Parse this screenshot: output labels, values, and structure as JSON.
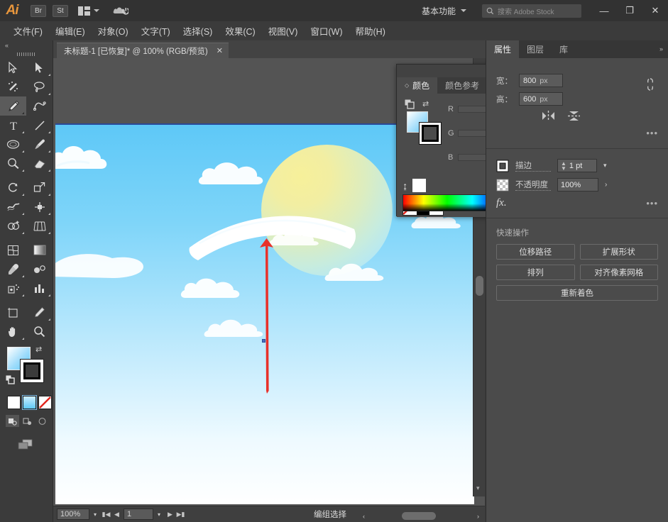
{
  "app": {
    "name": "Ai",
    "logo_label": "Ai"
  },
  "titlebar": {
    "bridge_label": "Br",
    "stock_label": "St",
    "arrange_icon": "arrange-documents-icon",
    "cc_icon": "creative-cloud-icon",
    "workspace": "基本功能",
    "workspace_chevron": "chevron-down-icon",
    "search_icon": "search-icon",
    "search_placeholder": "搜索 Adobe Stock",
    "minimize": "—",
    "maximize": "❐",
    "close": "✕"
  },
  "menubar": {
    "items": [
      {
        "label": "文件(F)"
      },
      {
        "label": "编辑(E)"
      },
      {
        "label": "对象(O)"
      },
      {
        "label": "文字(T)"
      },
      {
        "label": "选择(S)"
      },
      {
        "label": "效果(C)"
      },
      {
        "label": "视图(V)"
      },
      {
        "label": "窗口(W)"
      },
      {
        "label": "帮助(H)"
      }
    ]
  },
  "tabbar": {
    "document_title": "未标题-1 [已恢复]* @ 100% (RGB/预览)",
    "close_label": "✕",
    "overflow_chevron": "chevron-double-left-icon"
  },
  "toolbar": {
    "collapse_icon": "collapse-panel-icon",
    "tools": [
      {
        "name": "selection-tool",
        "selected": false
      },
      {
        "name": "direct-selection-tool",
        "selected": false
      },
      {
        "name": "magic-wand-tool",
        "selected": false
      },
      {
        "name": "lasso-tool",
        "selected": false
      },
      {
        "name": "pen-tool",
        "selected": true
      },
      {
        "name": "curvature-tool",
        "selected": false
      },
      {
        "name": "type-tool",
        "selected": false
      },
      {
        "name": "line-segment-tool",
        "selected": false
      },
      {
        "name": "ellipse-tool",
        "selected": false
      },
      {
        "name": "paintbrush-tool",
        "selected": false
      },
      {
        "name": "shaper-tool",
        "selected": false
      },
      {
        "name": "eraser-tool",
        "selected": false
      },
      {
        "name": "rotate-tool",
        "selected": false
      },
      {
        "name": "scale-tool",
        "selected": false
      },
      {
        "name": "width-tool",
        "selected": false
      },
      {
        "name": "free-transform-tool",
        "selected": false
      },
      {
        "name": "shape-builder-tool",
        "selected": false
      },
      {
        "name": "perspective-grid-tool",
        "selected": false
      },
      {
        "name": "mesh-tool",
        "selected": false
      },
      {
        "name": "gradient-tool",
        "selected": false
      },
      {
        "name": "eyedropper-tool",
        "selected": false
      },
      {
        "name": "blend-tool",
        "selected": false
      },
      {
        "name": "symbol-sprayer-tool",
        "selected": false
      },
      {
        "name": "column-graph-tool",
        "selected": false
      },
      {
        "name": "artboard-tool",
        "selected": false
      },
      {
        "name": "slice-tool",
        "selected": false
      },
      {
        "name": "hand-tool",
        "selected": false
      },
      {
        "name": "zoom-tool",
        "selected": false
      }
    ],
    "fill_label": "fill-swatch",
    "stroke_label": "stroke-swatch",
    "swap_icon": "swap-fill-stroke-icon",
    "default_icon": "default-fill-stroke-icon",
    "color_modes": [
      "color-swatch",
      "gradient-swatch",
      "none-swatch"
    ],
    "draw_modes": [
      "draw-normal",
      "draw-behind",
      "draw-inside"
    ],
    "screen_mode_icon": "change-screen-mode-icon"
  },
  "color_panel": {
    "collapse_icon": "collapse-icon",
    "close_icon": "close-icon",
    "menu_icon": "panel-menu-icon",
    "tabs": [
      {
        "label": "颜色",
        "active": true
      },
      {
        "label": "颜色参考",
        "active": false
      }
    ],
    "sliders": [
      {
        "label": "R",
        "value": ""
      },
      {
        "label": "G",
        "value": ""
      },
      {
        "label": "B",
        "value": ""
      }
    ],
    "hex_label": "#",
    "hex_value": "",
    "spectrum_name": "color-spectrum-bar",
    "fill_swatch": "gradient-fill-swatch",
    "stroke_swatch": "stroke-swatch",
    "swap_icon": "swap-fill-stroke-icon",
    "none_swatch": "none-swatch",
    "black_swatch": "black-swatch",
    "white_swatch": "white-swatch"
  },
  "dock": {
    "tabs": [
      {
        "label": "属性",
        "active": true
      },
      {
        "label": "图层",
        "active": false
      },
      {
        "label": "库",
        "active": false
      }
    ],
    "collapse_chevron": "chevron-double-right-icon"
  },
  "properties": {
    "transform": {
      "width_label": "宽：",
      "width_value": "800",
      "width_unit": "px",
      "height_label": "高：",
      "height_value": "600",
      "height_unit": "px",
      "link_icon": "unlink-proportions-icon",
      "flip_horizontal_icon": "flip-horizontal-icon",
      "flip_vertical_icon": "flip-vertical-icon",
      "more_options": "•••"
    },
    "appearance": {
      "stroke_icon": "stroke-swatch-icon",
      "stroke_label": "描边",
      "stroke_value": "1 pt",
      "stroke_stepper": "stepper-icon",
      "stroke_chevron": "chevron-down-icon",
      "opacity_icon": "opacity-checker-icon",
      "opacity_label": "不透明度",
      "opacity_value": "100%",
      "opacity_chevron": "chevron-right-icon",
      "fx_label": "fx.",
      "more_options": "•••"
    },
    "quick_actions": {
      "title": "快速操作",
      "buttons": [
        {
          "label": "位移路径"
        },
        {
          "label": "扩展形状"
        },
        {
          "label": "排列"
        },
        {
          "label": "对齐像素网格"
        },
        {
          "label": "重新着色",
          "full": true
        }
      ]
    }
  },
  "statusbar": {
    "zoom_value": "100%",
    "zoom_chevron": "chevron-down-icon",
    "first_page_icon": "first-page-icon",
    "prev_page_icon": "previous-page-icon",
    "page_value": "1",
    "page_chevron": "chevron-down-icon",
    "next_page_icon": "next-page-icon",
    "last_page_icon": "last-page-icon",
    "status_text": "编组选择",
    "status_chevron": "chevron-right-icon"
  },
  "artwork": {
    "description": "sky-illustration-with-clouds-sun-and-red-arrow",
    "sky_top_color": "#5ec8f7",
    "sky_bottom_color": "#ffffff",
    "sun_color": "#f2ee9e",
    "cloud_color": "#ffffff",
    "arrow_color": "#e8312a",
    "anchor_point": "selected-anchor-point"
  }
}
